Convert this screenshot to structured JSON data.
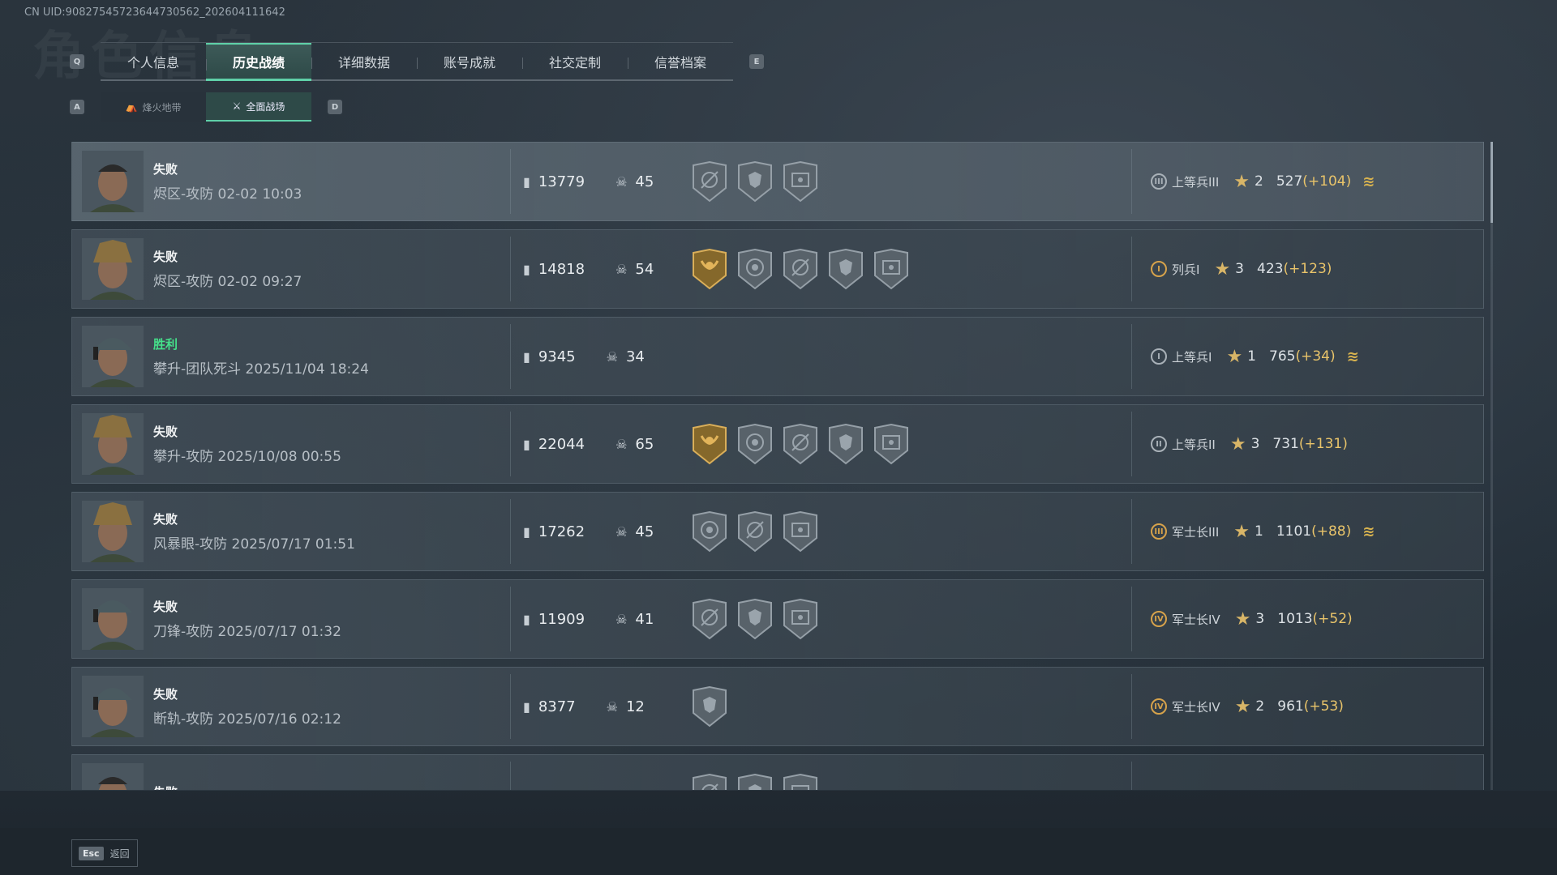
{
  "uid_text": "CN UID:9082754572364473056​2_202604111642",
  "watermark": "角色信息",
  "tabs": {
    "left_key": "Q",
    "right_key": "E",
    "items": [
      "个人信息",
      "历史战绩",
      "详细数据",
      "账号成就",
      "社交定制",
      "信誉档案"
    ],
    "active_index": 1
  },
  "subtabs": {
    "left_key": "A",
    "right_key": "D",
    "items": [
      "烽火地带",
      "全面战场"
    ],
    "active_index": 1
  },
  "matches": [
    {
      "result": "失败",
      "win": false,
      "mode": "烬区-攻防 02-02 10:03",
      "score": "13779",
      "kills": "45",
      "badges": [
        "crosshair",
        "skull-helmet",
        "eye-scope"
      ],
      "rank_roman": "III",
      "rank_tier": "silver",
      "rank": "上等兵III",
      "place": "2",
      "points": "527",
      "delta": "(+104)",
      "chevron": true
    },
    {
      "result": "失败",
      "win": false,
      "mode": "烬区-攻防 02-02 09:27",
      "score": "14818",
      "kills": "54",
      "badges": [
        "gold-laurel",
        "target-skull",
        "crosshair",
        "skull-helmet",
        "eye-scope"
      ],
      "rank_roman": "I",
      "rank_tier": "gold",
      "rank": "列兵I",
      "place": "3",
      "points": "423",
      "delta": "(+123)",
      "chevron": false
    },
    {
      "result": "胜利",
      "win": true,
      "mode": "攀升-团队死斗 2025/11/04 18:24",
      "score": "9345",
      "kills": "34",
      "badges": [],
      "rank_roman": "I",
      "rank_tier": "silver",
      "rank": "上等兵I",
      "place": "1",
      "points": "765",
      "delta": "(+34)",
      "chevron": true
    },
    {
      "result": "失败",
      "win": false,
      "mode": "攀升-攻防 2025/10/08 00:55",
      "score": "22044",
      "kills": "65",
      "badges": [
        "gold-laurel",
        "target-skull",
        "crosshair",
        "skull-helmet",
        "eye-scope"
      ],
      "rank_roman": "II",
      "rank_tier": "silver",
      "rank": "上等兵II",
      "place": "3",
      "points": "731",
      "delta": "(+131)",
      "chevron": false
    },
    {
      "result": "失败",
      "win": false,
      "mode": "风暴眼-攻防 2025/07/17 01:51",
      "score": "17262",
      "kills": "45",
      "badges": [
        "target-skull",
        "crosshair",
        "eye-scope"
      ],
      "rank_roman": "III",
      "rank_tier": "gold",
      "rank": "军士长III",
      "place": "1",
      "points": "1101",
      "delta": "(+88)",
      "chevron": true
    },
    {
      "result": "失败",
      "win": false,
      "mode": "刀锋-攻防 2025/07/17 01:32",
      "score": "11909",
      "kills": "41",
      "badges": [
        "crosshair",
        "skull-helmet",
        "eye-scope"
      ],
      "rank_roman": "IV",
      "rank_tier": "gold",
      "rank": "军士长IV",
      "place": "3",
      "points": "1013",
      "delta": "(+52)",
      "chevron": false
    },
    {
      "result": "失败",
      "win": false,
      "mode": "断轨-攻防 2025/07/16 02:12",
      "score": "8377",
      "kills": "12",
      "badges": [
        "skull-helmet"
      ],
      "rank_roman": "IV",
      "rank_tier": "gold",
      "rank": "军士长IV",
      "place": "2",
      "points": "961",
      "delta": "(+53)",
      "chevron": false
    },
    {
      "result": "失败",
      "win": false,
      "mode": "",
      "score": "",
      "kills": "",
      "badges": [
        "crosshair",
        "skull-helmet",
        "eye-scope"
      ],
      "rank_roman": "",
      "rank_tier": "gold",
      "rank": "",
      "place": "",
      "points": "",
      "delta": "",
      "chevron": true
    }
  ],
  "footer": {
    "key": "Esc",
    "label": "返回"
  },
  "colors": {
    "accent": "#5fd0a8",
    "win": "#45e08a",
    "delta": "#e9c46a",
    "gold": "#d6a24b"
  }
}
